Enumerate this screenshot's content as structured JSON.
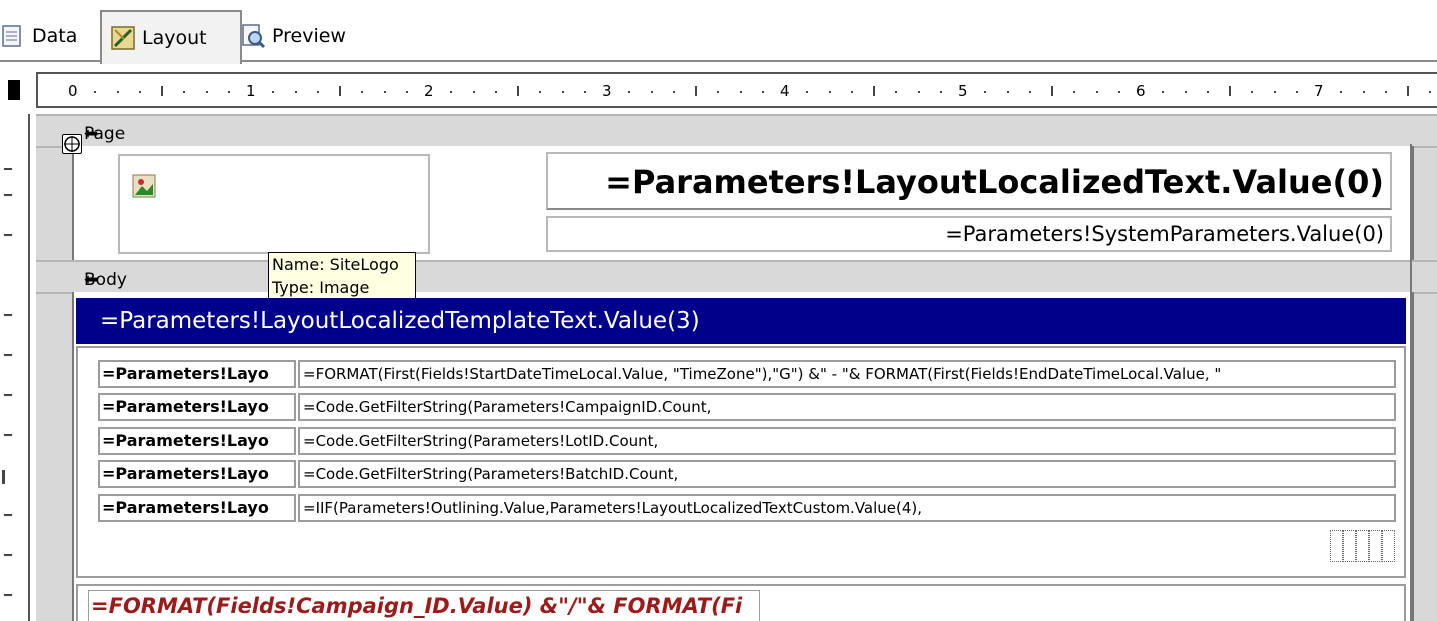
{
  "tabs": [
    {
      "label": "Data",
      "icon": "data-icon"
    },
    {
      "label": "Layout",
      "icon": "layout-icon"
    },
    {
      "label": "Preview",
      "icon": "preview-icon"
    }
  ],
  "ruler": {
    "marks": [
      "0",
      "1",
      "2",
      "3",
      "4",
      "5",
      "6",
      "7"
    ]
  },
  "page_header": {
    "label": "Page Header",
    "title_expression": "=Parameters!LayoutLocalizedText.Value(0)",
    "subtitle_expression": "=Parameters!SystemParameters.Value(0)"
  },
  "tooltip": {
    "line1": "Name: SiteLogo",
    "line2": "Type: Image"
  },
  "body": {
    "label": "Body",
    "header_expression": "=Parameters!LayoutLocalizedTemplateText.Value(3)",
    "filter_rows": [
      {
        "label": "=Parameters!Layo",
        "value": "=FORMAT(First(Fields!StartDateTimeLocal.Value, \"TimeZone\"),\"G\") &\" - \"& FORMAT(First(Fields!EndDateTimeLocal.Value, \""
      },
      {
        "label": "=Parameters!Layo",
        "value": "=Code.GetFilterString(Parameters!CampaignID.Count,"
      },
      {
        "label": "=Parameters!Layo",
        "value": "=Code.GetFilterString(Parameters!LotID.Count,"
      },
      {
        "label": "=Parameters!Layo",
        "value": "=Code.GetFilterString(Parameters!BatchID.Count,"
      },
      {
        "label": "=Parameters!Layo",
        "value": "=IIF(Parameters!Outlining.Value,Parameters!LayoutLocalizedTextCustom.Value(4),"
      }
    ],
    "bottom_expression": "=FORMAT(Fields!Campaign_ID.Value) &\"/\"& FORMAT(Fi"
  },
  "colors": {
    "header_band": "#00008b",
    "expression_red": "#9b1b1b",
    "tooltip_bg": "#ffffe1"
  }
}
